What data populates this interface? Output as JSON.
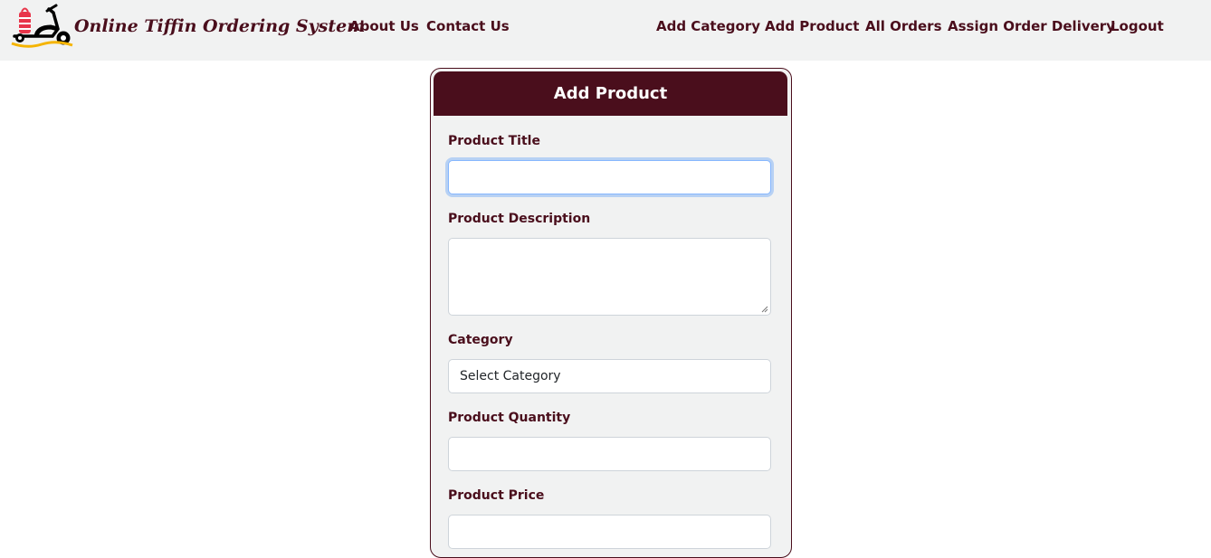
{
  "brand": {
    "name": "Online Tiffin Ordering System"
  },
  "nav": {
    "left": [
      "About Us",
      "Contact Us"
    ],
    "right": [
      "Add Category",
      "Add Product",
      "All Orders",
      "Assign Order Delivery",
      "Logout"
    ]
  },
  "form": {
    "title": "Add Product",
    "fields": {
      "title_label": "Product Title",
      "title_value": "",
      "description_label": "Product Description",
      "description_value": "",
      "category_label": "Category",
      "category_selected": "Select Category",
      "quantity_label": "Product Quantity",
      "quantity_value": "",
      "price_label": "Product Price",
      "price_value": ""
    }
  },
  "colors": {
    "brand": "#4a0e1c",
    "navbar_bg": "#f1f2f2",
    "logo_red": "#e8354a",
    "logo_yellow": "#f5b400"
  }
}
